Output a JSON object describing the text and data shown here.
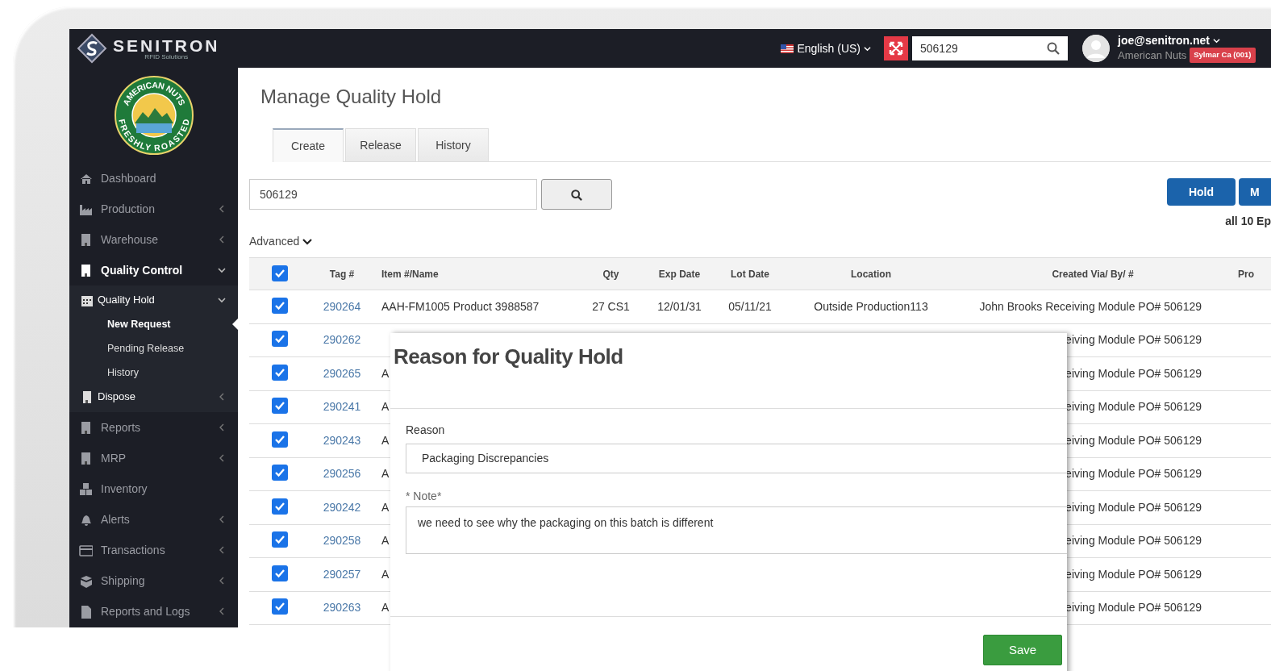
{
  "brand": {
    "name": "SENITRON",
    "tagline": "RFID Solutions"
  },
  "client_logo": {
    "top_text": "AMERICAN NUTS",
    "bottom_text": "FRESHLY ROASTED"
  },
  "topbar": {
    "language": "English (US)",
    "search": {
      "value": "506129"
    },
    "user": {
      "email": "joe@senitron.net",
      "company": "American Nuts",
      "site_badge": "Sylmar Ca (001)"
    }
  },
  "sidebar": {
    "items": [
      {
        "label": "Dashboard",
        "kind": "link",
        "selected": false
      },
      {
        "label": "Production",
        "kind": "group",
        "expanded": false,
        "selected": false
      },
      {
        "label": "Warehouse",
        "kind": "group",
        "expanded": false,
        "selected": false
      },
      {
        "label": "Quality Control",
        "kind": "group",
        "expanded": true,
        "selected": true,
        "children": [
          {
            "label": "Quality Hold",
            "kind": "group",
            "expanded": true,
            "selected": false,
            "children": [
              {
                "label": "New Request",
                "selected": true
              },
              {
                "label": "Pending Release",
                "selected": false
              },
              {
                "label": "History",
                "selected": false
              }
            ]
          },
          {
            "label": "Dispose",
            "kind": "group",
            "expanded": false,
            "selected": false
          }
        ]
      },
      {
        "label": "Reports",
        "kind": "group",
        "expanded": false,
        "selected": false
      },
      {
        "label": "MRP",
        "kind": "group",
        "expanded": false,
        "selected": false
      },
      {
        "label": "Inventory",
        "kind": "link",
        "selected": false
      },
      {
        "label": "Alerts",
        "kind": "group",
        "expanded": false,
        "selected": false
      },
      {
        "label": "Transactions",
        "kind": "group",
        "expanded": false,
        "selected": false
      },
      {
        "label": "Shipping",
        "kind": "group",
        "expanded": false,
        "selected": false
      },
      {
        "label": "Reports and Logs",
        "kind": "group",
        "expanded": false,
        "selected": false
      }
    ]
  },
  "page": {
    "title": "Manage Quality Hold",
    "tabs": [
      {
        "label": "Create",
        "selected": true
      },
      {
        "label": "Release",
        "selected": false
      },
      {
        "label": "History",
        "selected": false
      }
    ],
    "search": {
      "value": "506129"
    },
    "buttons": [
      "Hold",
      "M"
    ],
    "summary": "all 10 Ep",
    "advanced": "Advanced"
  },
  "table": {
    "select_all_checked": true,
    "columns": [
      "Tag #",
      "Item #/Name",
      "Qty",
      "Exp Date",
      "Lot Date",
      "Location",
      "Created Via/ By/ #",
      "Pro"
    ],
    "rows": [
      {
        "checked": true,
        "tag": "290264",
        "item": "AAH-FM1005 Product 3988587",
        "qty": "27 CS1",
        "exp_date": "12/01/31",
        "lot_date": "05/11/21",
        "location": "Outside Production113",
        "created": "John Brooks Receiving Module PO# 506129"
      },
      {
        "checked": true,
        "tag": "290262",
        "created": "eiving Module PO# 506129"
      },
      {
        "checked": true,
        "tag": "290265",
        "item": "A",
        "created": "eiving Module PO# 506129"
      },
      {
        "checked": true,
        "tag": "290241",
        "item": "A",
        "created": "eiving Module PO# 506129"
      },
      {
        "checked": true,
        "tag": "290243",
        "item": "A",
        "created": "eiving Module PO# 506129"
      },
      {
        "checked": true,
        "tag": "290256",
        "item": "A",
        "created": "eiving Module PO# 506129"
      },
      {
        "checked": true,
        "tag": "290242",
        "item": "A",
        "created": "eiving Module PO# 506129"
      },
      {
        "checked": true,
        "tag": "290258",
        "item": "A",
        "created": "eiving Module PO# 506129"
      },
      {
        "checked": true,
        "tag": "290257",
        "item": "A",
        "created": "eiving Module PO# 506129"
      },
      {
        "checked": true,
        "tag": "290263",
        "item": "A",
        "created": "eiving Module PO# 506129"
      }
    ]
  },
  "modal": {
    "title": "Reason for Quality Hold",
    "reason_label": "Reason",
    "reason_value": "Packaging Discrepancies",
    "note_label": "* Note*",
    "note_value": "we need to see why the packaging on this batch is different",
    "save": "Save"
  }
}
